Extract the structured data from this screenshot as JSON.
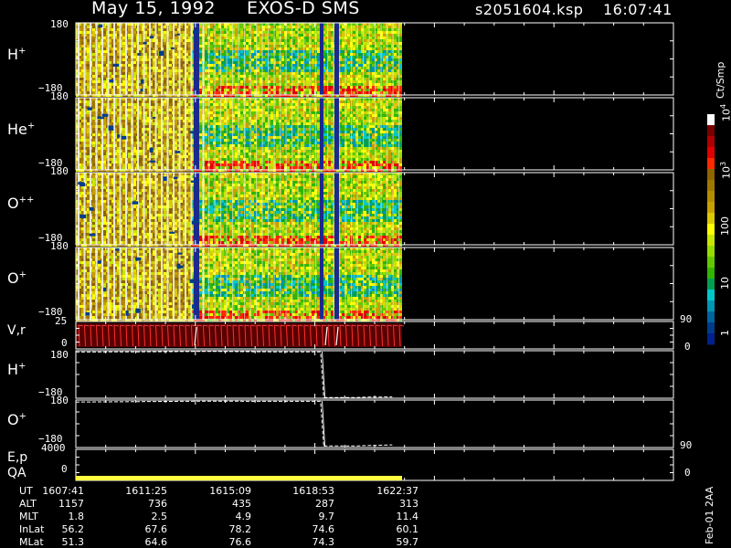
{
  "header": {
    "date": "May 15, 1992",
    "instrument": "EXOS-D SMS",
    "file": "s2051604.ksp",
    "time": "16:07:41"
  },
  "spectrogram_panels": [
    {
      "name": "H",
      "charge": "+",
      "ytop": "180",
      "ybot": "−180"
    },
    {
      "name": "He",
      "charge": "+",
      "ytop": "180",
      "ybot": "−180"
    },
    {
      "name": "O",
      "charge": "++",
      "ytop": "180",
      "ybot": "−180"
    },
    {
      "name": "O",
      "charge": "+",
      "ytop": "180",
      "ybot": "−180"
    }
  ],
  "vr_panel": {
    "label": "V,r",
    "left_top": "25",
    "left_zero": "0",
    "right_top": "90",
    "right_zero": "0"
  },
  "line_panels": [
    {
      "name": "H",
      "charge": "+",
      "ytop": "180",
      "ybot": "−180"
    },
    {
      "name": "O",
      "charge": "+",
      "ytop": "180",
      "ybot": "−180"
    }
  ],
  "ep_panel": {
    "label1": "E,p",
    "label2": "QA",
    "left_top": "4000",
    "left_zero": "0",
    "right_top": "90",
    "right_zero": "0"
  },
  "colorbar": {
    "unit": "Ct/Smp",
    "ticks": [
      {
        "base": "10",
        "exp": "4"
      },
      {
        "base": "10",
        "exp": "3"
      },
      {
        "base": "100",
        "exp": ""
      },
      {
        "base": "10",
        "exp": ""
      },
      {
        "base": "1",
        "exp": ""
      }
    ],
    "colors": [
      "#ffffff",
      "#7a0000",
      "#b00000",
      "#e00000",
      "#ff2800",
      "#8c6400",
      "#a07800",
      "#b48c00",
      "#c8a000",
      "#dcc800",
      "#ffff00",
      "#c8e600",
      "#96dc00",
      "#64c800",
      "#32b400",
      "#00a050",
      "#00c8c8",
      "#0096b4",
      "#0064a0",
      "#003c8c",
      "#00208c"
    ]
  },
  "footer": {
    "version": "Feb-01 2AA",
    "rows": [
      {
        "label": "UT",
        "values": [
          "1607:41",
          "1611:25",
          "1615:09",
          "1618:53",
          "1622:37"
        ]
      },
      {
        "label": "ALT",
        "values": [
          "1157",
          "736",
          "435",
          "287",
          "313"
        ]
      },
      {
        "label": "MLT",
        "values": [
          "1.8",
          "2.5",
          "4.9",
          "9.7",
          "11.4"
        ]
      },
      {
        "label": "InLat",
        "values": [
          "56.2",
          "67.6",
          "78.2",
          "74.6",
          "60.1"
        ]
      },
      {
        "label": "MLat",
        "values": [
          "51.3",
          "64.6",
          "76.6",
          "74.3",
          "59.7"
        ]
      }
    ]
  },
  "chart_data": {
    "type": "heatmap",
    "x_ticks": [
      "1607:41",
      "1611:25",
      "1615:09",
      "1618:53",
      "1622:37"
    ],
    "spectrogram_ylim": [
      -180,
      180
    ],
    "vr_ylim": [
      0,
      25
    ],
    "ep_ylim": [
      0,
      4000
    ],
    "line_series": [
      {
        "panel": "H+",
        "x": [
          0,
          0.2,
          0.4,
          0.6,
          0.75,
          0.76,
          0.85,
          0.9,
          0.97
        ],
        "y": [
          170,
          172,
          175,
          172,
          172,
          -175,
          -175,
          -172,
          -170
        ]
      },
      {
        "panel": "O+",
        "x": [
          0,
          0.2,
          0.4,
          0.6,
          0.75,
          0.76,
          0.85,
          0.9,
          0.97
        ],
        "y": [
          165,
          168,
          172,
          170,
          170,
          -168,
          -168,
          -165,
          -160
        ]
      }
    ]
  }
}
